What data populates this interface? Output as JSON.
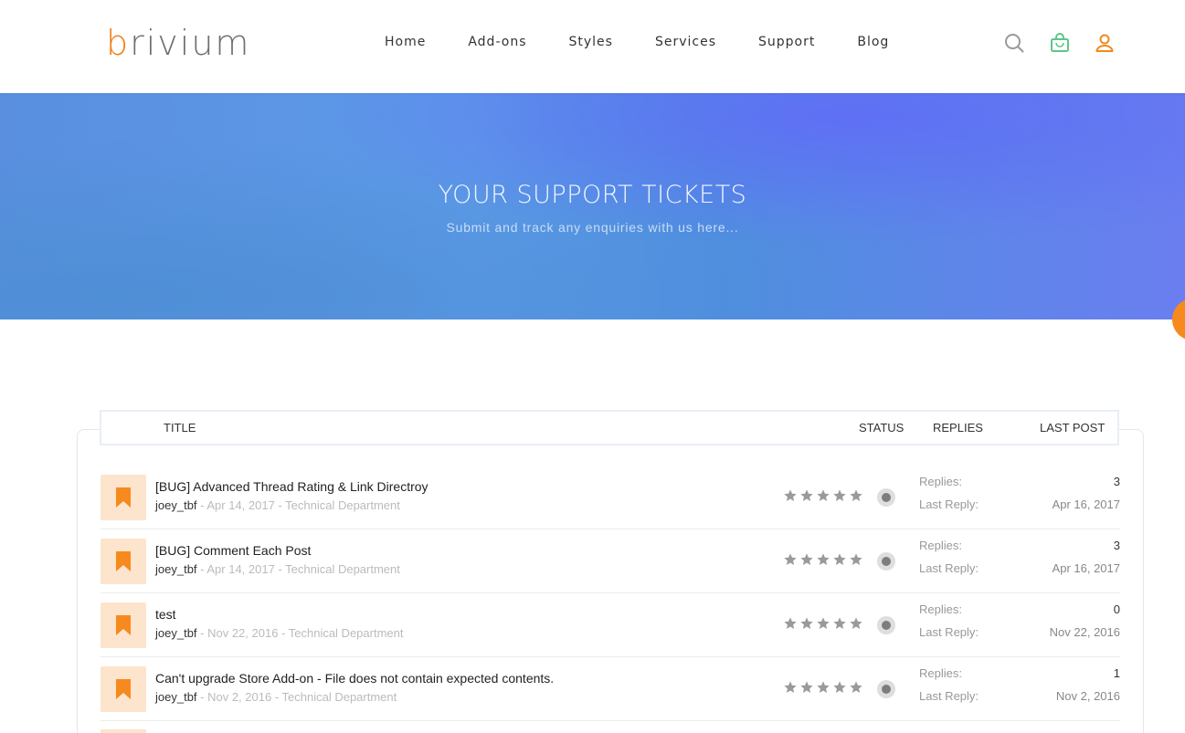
{
  "header": {
    "logo_first": "b",
    "logo_rest": "rivium",
    "nav": [
      {
        "label": "Home"
      },
      {
        "label": "Add-ons"
      },
      {
        "label": "Styles"
      },
      {
        "label": "Services"
      },
      {
        "label": "Support"
      },
      {
        "label": "Blog"
      }
    ],
    "icons": [
      "search-icon",
      "shopping-bag-icon",
      "user-icon"
    ]
  },
  "banner": {
    "title": "YOUR SUPPORT TICKETS",
    "subtitle": "Submit and track any enquiries with us here..."
  },
  "table": {
    "headers": {
      "title": "TITLE",
      "status": "STATUS",
      "replies": "REPLIES",
      "last_post": "LAST POST"
    },
    "replies_label": "Replies:",
    "last_reply_label": "Last Reply:",
    "rows": [
      {
        "title": "[BUG] Advanced Thread Rating & Link Directroy",
        "user": "joey_tbf",
        "meta": " - Apr 14, 2017 - Technical Department",
        "replies": "3",
        "last_reply": "Apr 16, 2017"
      },
      {
        "title": "[BUG] Comment Each Post",
        "user": "joey_tbf",
        "meta": " - Apr 14, 2017 - Technical Department",
        "replies": "3",
        "last_reply": "Apr 16, 2017"
      },
      {
        "title": "test",
        "user": "joey_tbf",
        "meta": " - Nov 22, 2016 - Technical Department",
        "replies": "0",
        "last_reply": "Nov 22, 2016"
      },
      {
        "title": "Can't upgrade Store Add-on - File does not contain expected contents.",
        "user": "joey_tbf",
        "meta": " - Nov 2, 2016 - Technical Department",
        "replies": "1",
        "last_reply": "Nov 2, 2016"
      }
    ]
  },
  "colors": {
    "brand_orange": "#f07f1a",
    "icon_bg": "#fde4cc",
    "bag_green": "#5fc58a"
  }
}
